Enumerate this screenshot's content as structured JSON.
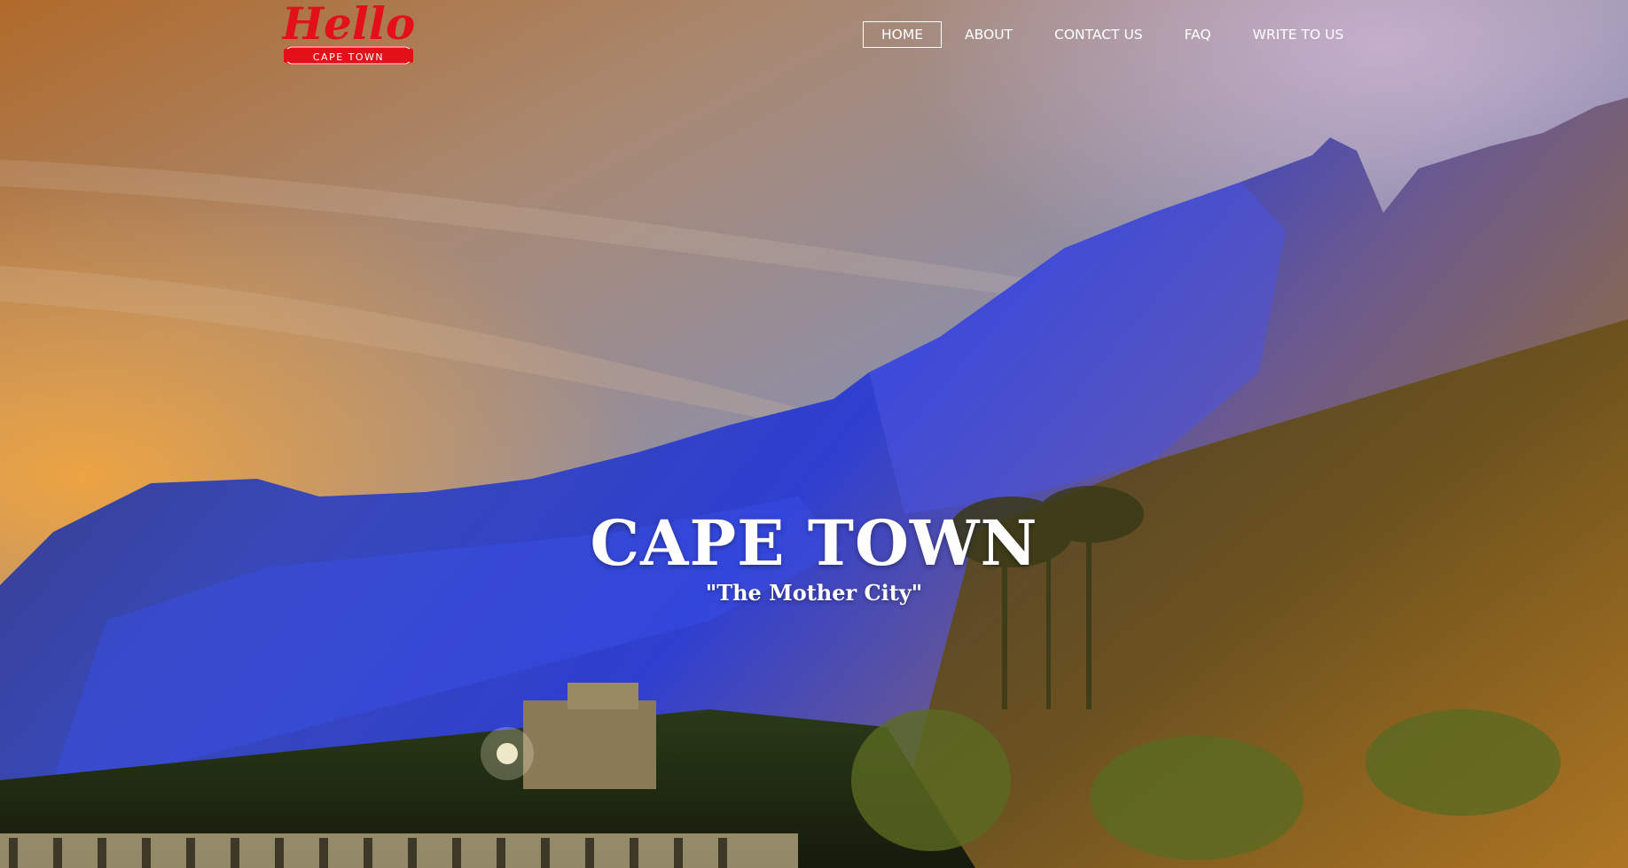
{
  "logo": {
    "script_text": "Hello",
    "banner_text": "CAPE TOWN",
    "color": "#e3101a"
  },
  "nav": {
    "items": [
      {
        "label": "HOME",
        "active": true
      },
      {
        "label": "ABOUT",
        "active": false
      },
      {
        "label": "CONTACT US",
        "active": false
      },
      {
        "label": "FAQ",
        "active": false
      },
      {
        "label": "WRITE TO US",
        "active": false
      }
    ]
  },
  "hero": {
    "title": "CAPE TOWN",
    "subtitle": "\"The Mother City\""
  }
}
